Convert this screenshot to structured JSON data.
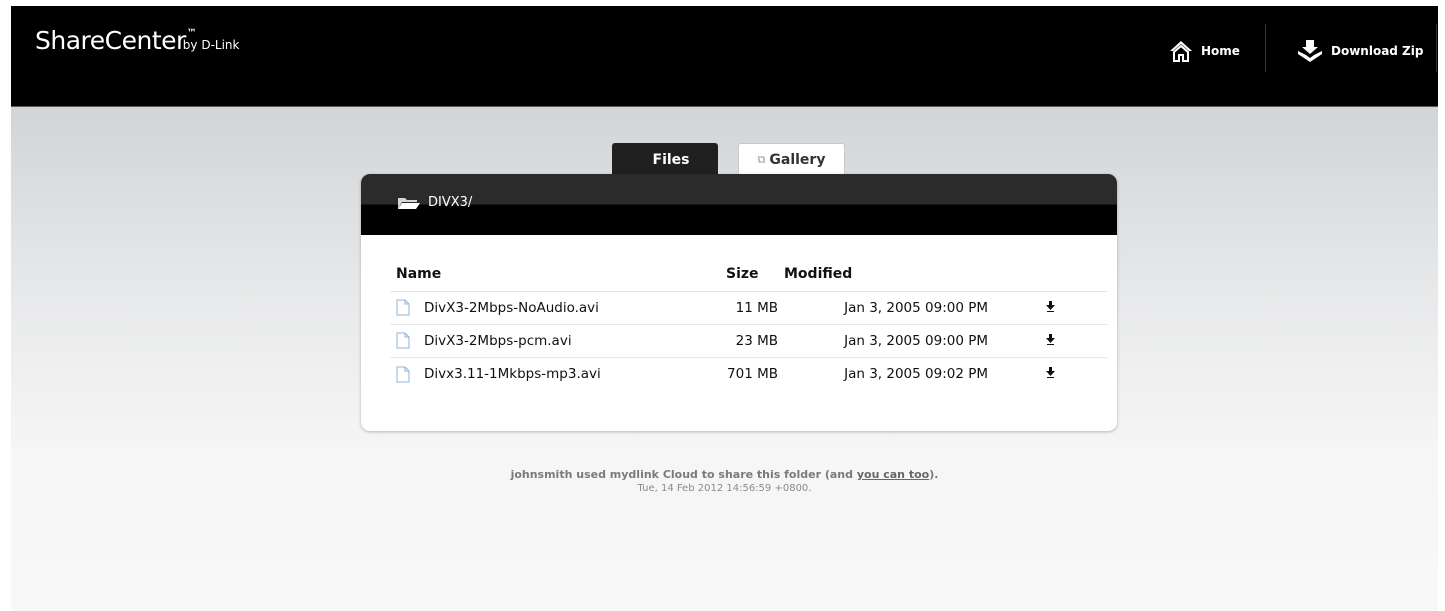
{
  "header": {
    "brand": "ShareCenter",
    "tm": "™",
    "by": "by D-Link",
    "home_label": "Home",
    "download_zip_label": "Download Zip"
  },
  "tabs": {
    "files_label": "Files",
    "gallery_label": "Gallery"
  },
  "folder": {
    "path": "DIVX3/"
  },
  "table": {
    "columns": {
      "name": "Name",
      "size": "Size",
      "modified": "Modified"
    },
    "rows": [
      {
        "name": "DivX3-2Mbps-NoAudio.avi",
        "size": "11 MB",
        "modified": "Jan 3, 2005 09:00 PM"
      },
      {
        "name": "DivX3-2Mbps-pcm.avi",
        "size": "23 MB",
        "modified": "Jan 3, 2005 09:00 PM"
      },
      {
        "name": "Divx3.11-1Mkbps-mp3.avi",
        "size": "701 MB",
        "modified": "Jan 3, 2005 09:02 PM"
      }
    ]
  },
  "footer": {
    "text_before": "johnsmith used mydlink Cloud to share this folder (and ",
    "link": "you can too",
    "text_after": ").",
    "timestamp": "Tue, 14 Feb 2012 14:56:59 +0800."
  },
  "icons": {
    "home": "home-icon",
    "download_zip": "download-zip-icon",
    "gallery": "gallery-icon",
    "folder": "folder-open-icon",
    "file": "file-icon",
    "download": "download-arrow-icon"
  },
  "colors": {
    "header_bg": "#000000",
    "panel_head_top": "#2b2b2b",
    "active_tab": "#202020"
  }
}
